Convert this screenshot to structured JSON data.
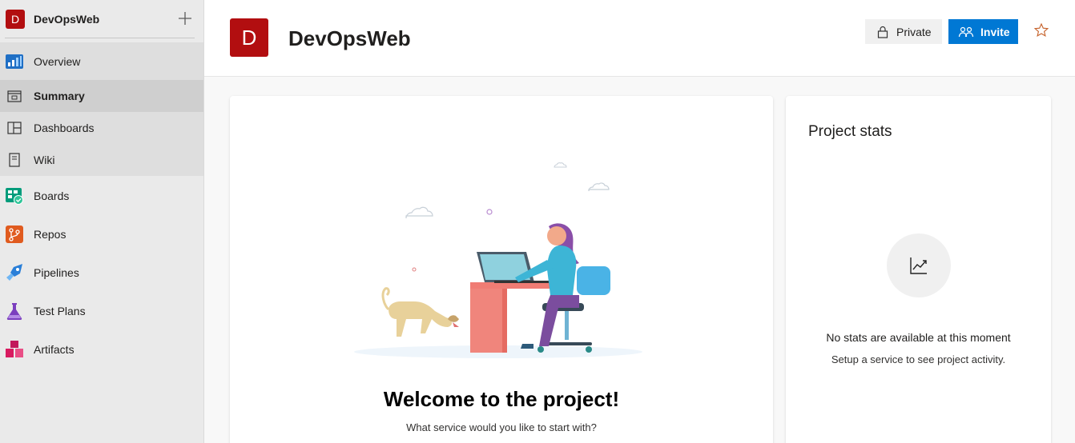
{
  "sidebar": {
    "project_initial": "D",
    "project_name": "DevOpsWeb",
    "items": [
      {
        "label": "Overview",
        "icon": "overview-icon"
      },
      {
        "label": "Summary",
        "icon": "summary-icon"
      },
      {
        "label": "Dashboards",
        "icon": "dashboards-icon"
      },
      {
        "label": "Wiki",
        "icon": "wiki-icon"
      },
      {
        "label": "Boards",
        "icon": "boards-icon"
      },
      {
        "label": "Repos",
        "icon": "repos-icon"
      },
      {
        "label": "Pipelines",
        "icon": "pipelines-icon"
      },
      {
        "label": "Test Plans",
        "icon": "test-plans-icon"
      },
      {
        "label": "Artifacts",
        "icon": "artifacts-icon"
      }
    ],
    "active_item": "Summary"
  },
  "header": {
    "project_initial": "D",
    "title": "DevOpsWeb",
    "private_label": "Private",
    "invite_label": "Invite"
  },
  "welcome": {
    "title": "Welcome to the project!",
    "subtitle": "What service would you like to start with?"
  },
  "stats": {
    "title": "Project stats",
    "empty_title": "No stats are available at this moment",
    "empty_subtitle": "Setup a service to see project activity."
  },
  "colors": {
    "brand": "#b20e10",
    "accent": "#0078d4",
    "sidebar_bg": "#eaeaea",
    "active_bg": "#cfcfcf"
  }
}
